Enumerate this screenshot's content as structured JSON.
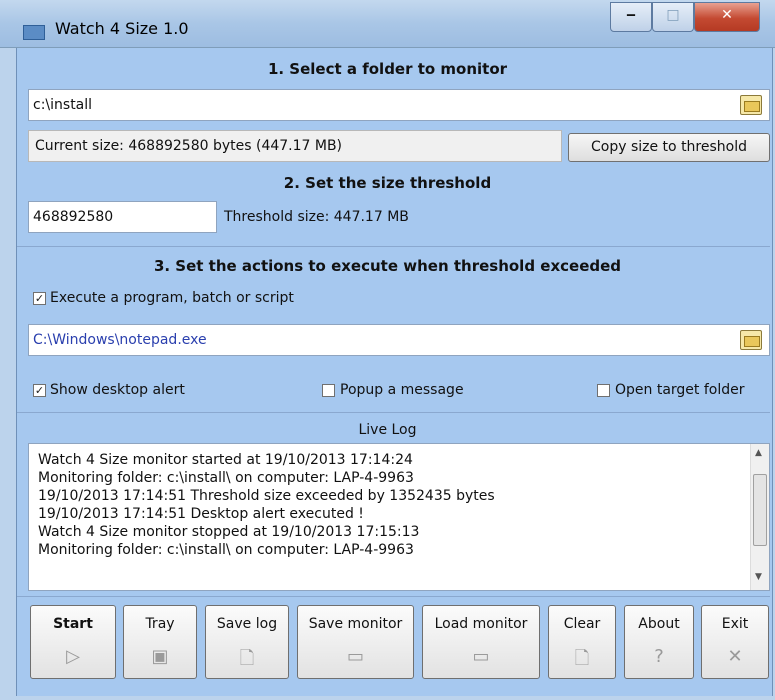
{
  "window": {
    "title": "Watch 4 Size 1.0",
    "min": "‒",
    "max": "□",
    "close": "✕"
  },
  "section1": {
    "heading": "1. Select a folder to monitor",
    "folder_value": "c:\\install",
    "current_size": "Current size: 468892580 bytes (447.17 MB)",
    "copy_button": "Copy size to threshold"
  },
  "section2": {
    "heading": "2. Set the size threshold",
    "threshold_value": "468892580",
    "threshold_size": "Threshold size: 447.17 MB"
  },
  "section3": {
    "heading": "3. Set the actions to execute when threshold exceeded",
    "exec_label": "Execute a program, batch or script",
    "exec_checked": true,
    "program_value": "C:\\Windows\\notepad.exe",
    "alert_label": "Show desktop alert",
    "alert_checked": true,
    "popup_label": "Popup a message",
    "popup_checked": false,
    "open_label": "Open target folder",
    "open_checked": false
  },
  "live_log": {
    "heading": "Live Log",
    "lines": [
      "Watch 4 Size monitor started at 19/10/2013 17:14:24",
      "Monitoring folder: c:\\install\\ on computer: LAP-4-9963",
      " 19/10/2013 17:14:51 Threshold size exceeded by 1352435 bytes",
      " 19/10/2013 17:14:51 Desktop alert executed !",
      "Watch 4 Size monitor stopped at 19/10/2013 17:15:13",
      "Monitoring folder: c:\\install\\ on computer: LAP-4-9963"
    ]
  },
  "toolbar": {
    "start": "Start",
    "tray": "Tray",
    "save_log": "Save log",
    "save_monitor": "Save monitor",
    "load_monitor": "Load monitor",
    "clear": "Clear",
    "about": "About",
    "exit": "Exit"
  },
  "icons": {
    "start": "▷",
    "tray": "▣",
    "save_log": "🗋",
    "save_monitor": "▭",
    "load_monitor": "▭",
    "clear": "🗋",
    "about": "?",
    "exit": "✕"
  }
}
